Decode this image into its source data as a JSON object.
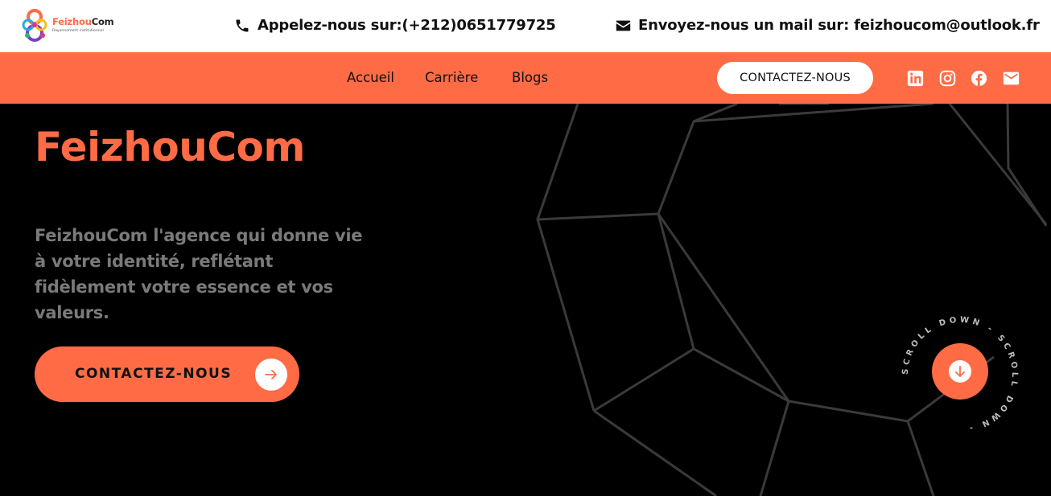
{
  "brand": {
    "name_part1": "Feizhou",
    "name_part2": "Com",
    "tagline": "Rayonnement institutionnel"
  },
  "topbar": {
    "phone_icon": "phone-icon",
    "phone_text": "Appelez-nous sur:(+212)0651779725",
    "mail_icon": "envelope-icon",
    "mail_text": "Envoyez-nous un mail sur: feizhoucom@outlook.fr"
  },
  "nav": {
    "links": [
      "Accueil",
      "Carrière",
      "Blogs"
    ],
    "cta_label": "CONTACTEZ-NOUS",
    "social_icons": [
      "linkedin-icon",
      "instagram-icon",
      "facebook-icon",
      "mail-icon"
    ]
  },
  "hero": {
    "title": "FeizhouCom",
    "description": "FeizhouCom l'agence qui donne vie à votre identité, reflétant fidèlement votre essence et vos valeurs.",
    "cta_label": "CONTACTEZ-NOUS",
    "cta_icon": "arrow-right-icon",
    "scroll_text": "SCROLL DOWN - SCROLL DOWN - ",
    "scroll_icon": "arrow-down-icon"
  },
  "colors": {
    "accent": "#ff6b45",
    "background": "#000000",
    "topbar": "#ffffff",
    "description_text": "#7a7a7a",
    "wireframe": "#3a3a3a"
  }
}
